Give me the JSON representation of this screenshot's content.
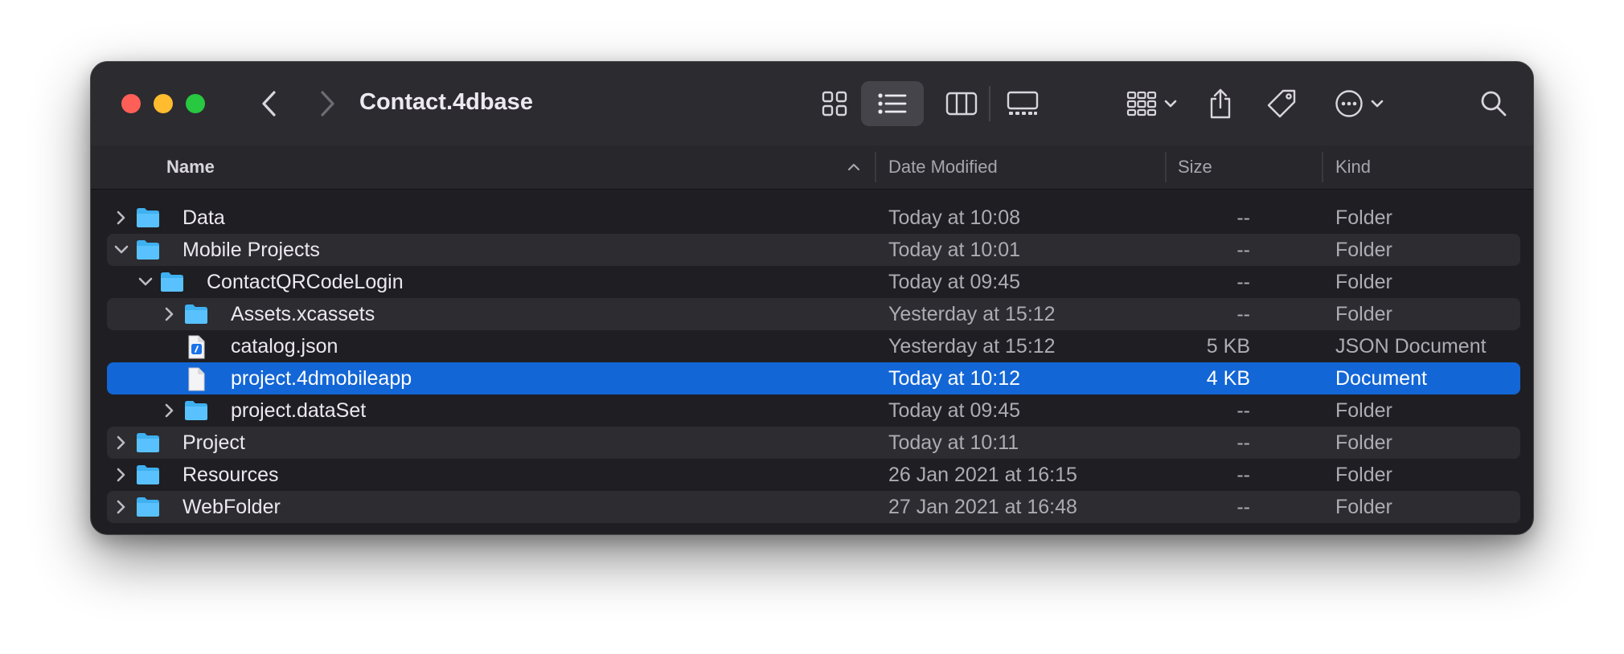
{
  "window": {
    "title": "Contact.4dbase"
  },
  "toolbar": {
    "icons": [
      "chevron-left-icon",
      "chevron-right-icon",
      "icon-view-icon",
      "list-view-icon",
      "column-view-icon",
      "gallery-view-icon",
      "group-icon",
      "share-icon",
      "tag-icon",
      "more-actions-icon",
      "search-icon"
    ],
    "active_view": "list-view"
  },
  "columns": {
    "name": "Name",
    "date": "Date Modified",
    "size": "Size",
    "kind": "Kind",
    "sort": "name-ascending"
  },
  "colors": {
    "folder": "#3fb0f0",
    "selection": "#1366d6",
    "close": "#ff5f57",
    "minimize": "#febc2e",
    "maximize": "#28c840"
  },
  "rows": [
    {
      "name": "Data",
      "date": "Today at 10:08",
      "size": "--",
      "kind": "Folder",
      "level": 0,
      "type": "folder",
      "expanded": false
    },
    {
      "name": "Mobile Projects",
      "date": "Today at 10:01",
      "size": "--",
      "kind": "Folder",
      "level": 0,
      "type": "folder",
      "expanded": true
    },
    {
      "name": "ContactQRCodeLogin",
      "date": "Today at 09:45",
      "size": "--",
      "kind": "Folder",
      "level": 1,
      "type": "folder",
      "expanded": true
    },
    {
      "name": "Assets.xcassets",
      "date": "Yesterday at 15:12",
      "size": "--",
      "kind": "Folder",
      "level": 2,
      "type": "folder",
      "expanded": false
    },
    {
      "name": "catalog.json",
      "date": "Yesterday at 15:12",
      "size": "5 KB",
      "kind": "JSON Document",
      "level": 2,
      "type": "json"
    },
    {
      "name": "project.4dmobileapp",
      "date": "Today at 10:12",
      "size": "4 KB",
      "kind": "Document",
      "level": 2,
      "type": "doc",
      "selected": true
    },
    {
      "name": "project.dataSet",
      "date": "Today at 09:45",
      "size": "--",
      "kind": "Folder",
      "level": 2,
      "type": "folder",
      "expanded": false
    },
    {
      "name": "Project",
      "date": "Today at 10:11",
      "size": "--",
      "kind": "Folder",
      "level": 0,
      "type": "folder",
      "expanded": false
    },
    {
      "name": "Resources",
      "date": "26 Jan 2021 at 16:15",
      "size": "--",
      "kind": "Folder",
      "level": 0,
      "type": "folder",
      "expanded": false
    },
    {
      "name": "WebFolder",
      "date": "27 Jan 2021 at 16:48",
      "size": "--",
      "kind": "Folder",
      "level": 0,
      "type": "folder",
      "expanded": false
    }
  ]
}
